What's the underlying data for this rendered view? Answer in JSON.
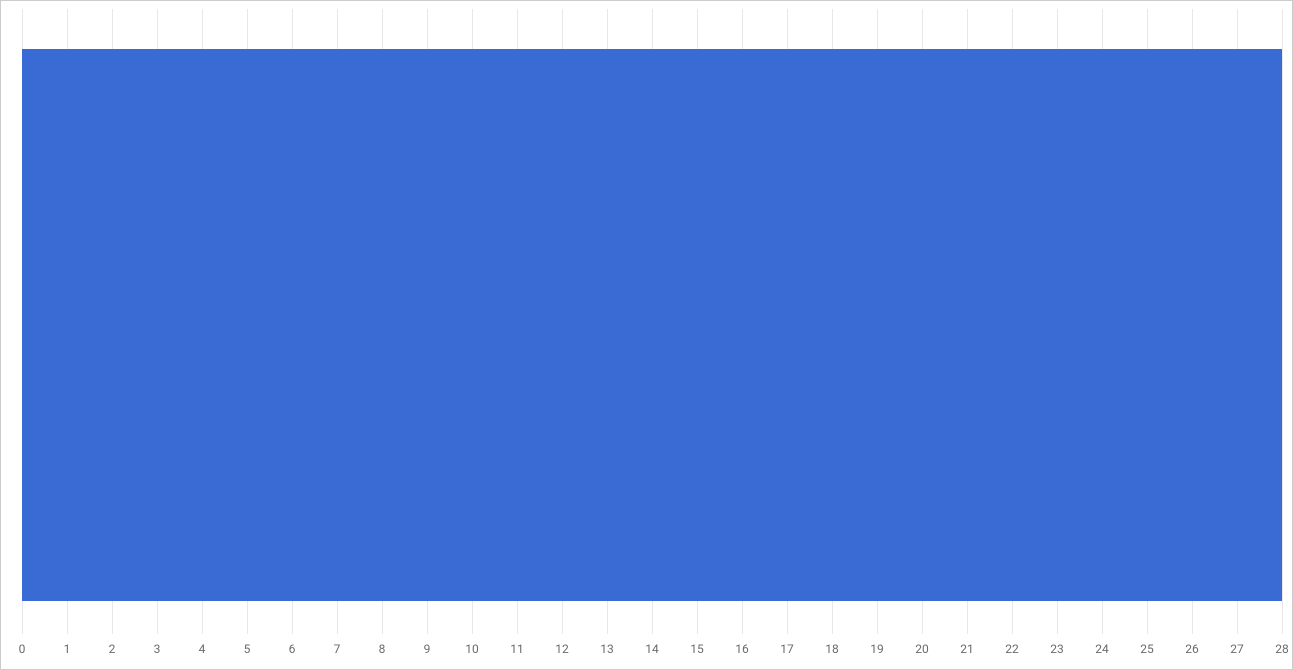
{
  "chart_data": {
    "type": "bar",
    "orientation": "horizontal",
    "categories": [
      ""
    ],
    "values": [
      28
    ],
    "xlim": [
      0,
      28
    ],
    "x_ticks": [
      0,
      1,
      2,
      3,
      4,
      5,
      6,
      7,
      8,
      9,
      10,
      11,
      12,
      13,
      14,
      15,
      16,
      17,
      18,
      19,
      20,
      21,
      22,
      23,
      24,
      25,
      26,
      27,
      28
    ],
    "bar_color": "#3a6ad4",
    "title": "",
    "xlabel": "",
    "ylabel": ""
  }
}
